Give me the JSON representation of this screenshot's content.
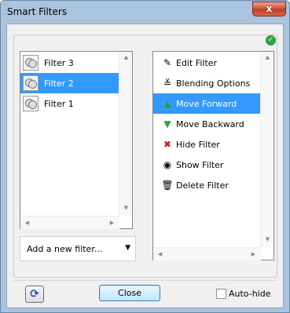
{
  "window": {
    "title": "Smart Filters",
    "close_glyph": "x"
  },
  "status_icon": {
    "glyph": "✓",
    "icon": "check-circle-icon",
    "color": "#2e9e47"
  },
  "filters": [
    {
      "label": "Filter 3",
      "selected": false
    },
    {
      "label": "Filter 2",
      "selected": true
    },
    {
      "label": "Filter 1",
      "selected": false
    }
  ],
  "actions": [
    {
      "label": "Edit Filter",
      "icon": "brush-icon",
      "glyph": "✎",
      "selected": false
    },
    {
      "label": "Blending Options",
      "icon": "blend-options-icon",
      "glyph": "≚",
      "selected": false
    },
    {
      "label": "Move Forward",
      "icon": "move-forward-icon",
      "glyph": "▲",
      "selected": true
    },
    {
      "label": "Move Backward",
      "icon": "move-backward-icon",
      "glyph": "▼",
      "selected": false
    },
    {
      "label": "Hide Filter",
      "icon": "hide-filter-icon",
      "glyph": "✖",
      "selected": false
    },
    {
      "label": "Show Filter",
      "icon": "eye-icon",
      "glyph": "◉",
      "selected": false
    },
    {
      "label": "Delete Filter",
      "icon": "trash-icon",
      "glyph": "🗑",
      "selected": false
    }
  ],
  "add_filter": {
    "label": "Add a new filter..."
  },
  "footer": {
    "refresh_glyph": "⟳",
    "close_label": "Close",
    "autohide_label": "Auto-hide",
    "autohide_checked": false
  },
  "colors": {
    "selection": "#3399ff",
    "accent_green": "#2e9e47"
  }
}
